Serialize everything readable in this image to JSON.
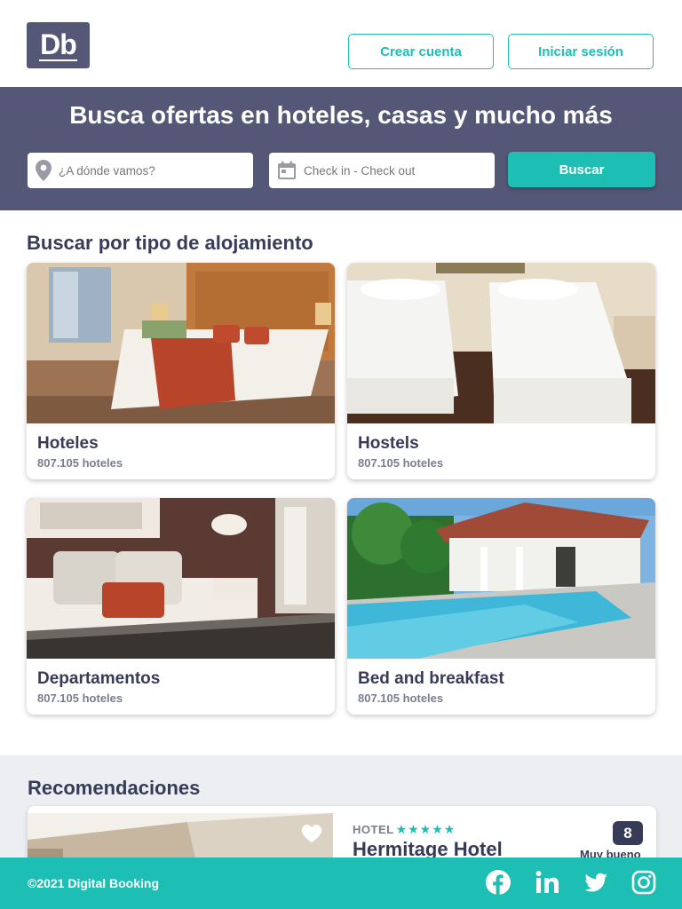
{
  "header": {
    "logo_text": "Db",
    "create_account_label": "Crear cuenta",
    "login_label": "Iniciar sesión"
  },
  "search": {
    "title": "Busca ofertas en hoteles, casas y mucho más",
    "destination_placeholder": "¿A dónde vamos?",
    "dates_placeholder": "Check in - Check out",
    "submit_label": "Buscar"
  },
  "categories": {
    "title": "Buscar por tipo de alojamiento",
    "items": [
      {
        "label": "Hoteles",
        "count": "807.105 hoteles"
      },
      {
        "label": "Hostels",
        "count": "807.105 hoteles"
      },
      {
        "label": "Departamentos",
        "count": "807.105 hoteles"
      },
      {
        "label": "Bed and breakfast",
        "count": "807.105 hoteles"
      }
    ]
  },
  "recommendations": {
    "title": "Recomendaciones",
    "items": [
      {
        "category": "HOTEL",
        "stars": "★★★★★",
        "name": "Hermitage Hotel",
        "score": "8",
        "score_label": "Muy bueno"
      }
    ]
  },
  "footer": {
    "copyright": "©2021 Digital Booking"
  },
  "colors": {
    "brand_dark": "#545776",
    "accent": "#1dbeb4",
    "text_dark": "#383b58"
  },
  "icons": [
    "location-pin-icon",
    "calendar-icon",
    "heart-icon",
    "facebook-icon",
    "linkedin-icon",
    "twitter-icon",
    "instagram-icon"
  ]
}
